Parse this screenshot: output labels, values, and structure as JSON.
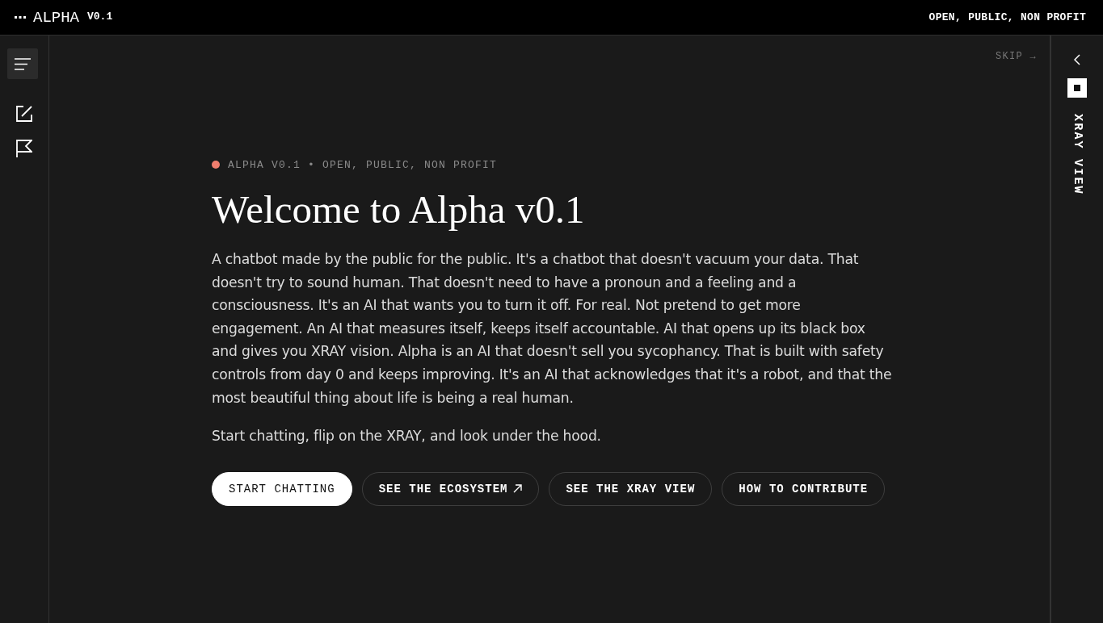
{
  "top_bar": {
    "brand": "ALPHA",
    "version": "V0.1",
    "tagline": "OPEN, PUBLIC, NON PROFIT"
  },
  "main": {
    "skip": "SKIP →"
  },
  "hero": {
    "eyebrow": "ALPHA V0.1 • OPEN, PUBLIC, NON PROFIT",
    "title": "Welcome to Alpha v0.1",
    "paragraphs": [
      "A chatbot made by the public for the public. It's a chatbot that doesn't vacuum your data. That doesn't try to sound human. That doesn't need to have a pronoun and a feeling and a consciousness. It's an AI that wants you to turn it off. For real. Not pretend to get more engagement. An AI that measures itself, keeps itself accountable. AI that opens up its black box and gives you XRAY vision. Alpha is an AI that doesn't sell you sycophancy. That is built with safety controls from day 0 and keeps improving. It's an AI that acknowledges that it's a robot, and that the most beautiful thing about life is being a real human.",
      "Start chatting, flip on the XRAY, and look under the hood."
    ],
    "buttons": [
      {
        "label": "START CHATTING",
        "kind": "primary"
      },
      {
        "label": "SEE THE ECOSYSTEM",
        "kind": "external"
      },
      {
        "label": "SEE THE XRAY VIEW",
        "kind": "secondary"
      },
      {
        "label": "HOW TO CONTRIBUTE",
        "kind": "secondary"
      }
    ]
  },
  "xray_panel": {
    "label": "XRAY VIEW"
  }
}
